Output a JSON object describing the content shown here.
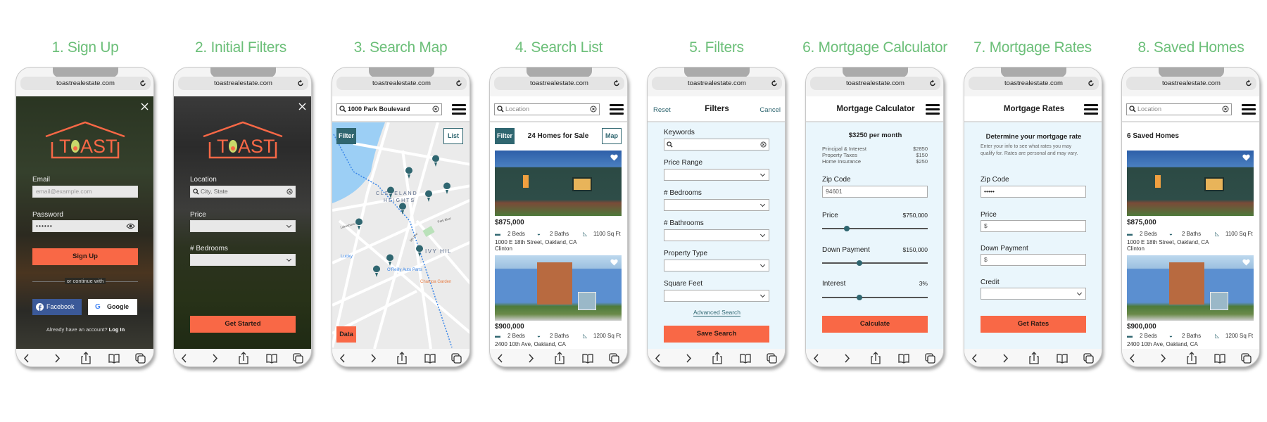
{
  "colors": {
    "accent": "#f96846",
    "teal": "#2f6670",
    "title_green": "#6cbf79",
    "filter_bg": "#eaf6fc",
    "facebook": "#3b5998"
  },
  "browser": {
    "url": "toastrealestate.com",
    "icons": [
      "reload-icon",
      "back-icon",
      "forward-icon",
      "share-icon",
      "bookmarks-icon",
      "tabs-icon"
    ]
  },
  "screens": [
    {
      "title": "1. Sign Up",
      "logo_text": "TOAST",
      "email_label": "Email",
      "email_placeholder": "email@example.com",
      "password_label": "Password",
      "password_value": "••••••",
      "signup_button": "Sign Up",
      "divider_text": "or continue with",
      "facebook_button": "Facebook",
      "google_button": "Google",
      "login_prompt": "Already have an account?",
      "login_link": "Log In"
    },
    {
      "title": "2. Initial Filters",
      "logo_text": "TOAST",
      "location_label": "Location",
      "location_placeholder": "City, State",
      "price_label": "Price",
      "bedrooms_label": "# Bedrooms",
      "get_started_button": "Get Started"
    },
    {
      "title": "3. Search Map",
      "search_value": "1000 Park Boulevard",
      "filter_button": "Filter",
      "list_button": "List",
      "data_button": "Data",
      "map_labels": [
        "CLEVELAND",
        "HEIGHTS",
        "IVY HIL",
        "Lucky",
        "O'Reilly Auto Parts",
        "Champa Garden",
        "Lakeshore Ave",
        "Park Blvd",
        "5th Ave"
      ]
    },
    {
      "title": "4. Search List",
      "search_placeholder": "Location",
      "filter_button": "Filter",
      "heading": "24 Homes for Sale",
      "map_button": "Map"
    },
    {
      "title": "5. Filters",
      "reset": "Reset",
      "heading": "Filters",
      "cancel": "Cancel",
      "fields": [
        "Keywords",
        "Price Range",
        "# Bedrooms",
        "# Bathrooms",
        "Property Type",
        "Square Feet"
      ],
      "advanced_link": "Advanced Search",
      "save_button": "Save Search"
    },
    {
      "title": "6. Mortgage Calculator",
      "heading": "Mortgage Calculator",
      "monthly": "$3250 per month",
      "breakdown": [
        {
          "label": "Principal & Interest",
          "value": "$2850"
        },
        {
          "label": "Property Taxes",
          "value": "$150"
        },
        {
          "label": "Home Insurance",
          "value": "$250"
        }
      ],
      "zip_label": "Zip Code",
      "zip_value": "94601",
      "price_label": "Price",
      "price_value": "$750,000",
      "price_slider": 0.23,
      "down_label": "Down Payment",
      "down_value": "$150,000",
      "down_slider": 0.35,
      "interest_label": "Interest",
      "interest_value": "3%",
      "interest_slider": 0.35,
      "calculate_button": "Calculate"
    },
    {
      "title": "7. Mortgage Rates",
      "heading": "Mortgage Rates",
      "subheading": "Determine your mortgage rate",
      "description": "Enter your info to see what rates you may qualify for. Rates are personal and may vary.",
      "zip_label": "Zip Code",
      "zip_value": "•••••",
      "price_label": "Price",
      "price_placeholder": "$",
      "down_label": "Down Payment",
      "down_placeholder": "$",
      "credit_label": "Credit",
      "rates_button": "Get Rates"
    },
    {
      "title": "8. Saved Homes",
      "search_placeholder": "Location",
      "heading": "6 Saved Homes"
    }
  ],
  "listings": [
    {
      "price": "$875,000",
      "beds": "2 Beds",
      "baths": "2 Baths",
      "sqft": "1100 Sq Ft",
      "address": "1000 E 18th Street, Oakland, CA",
      "neighborhood": "Clinton"
    },
    {
      "price": "$900,000",
      "beds": "2 Beds",
      "baths": "2 Baths",
      "sqft": "1200 Sq Ft",
      "address": "2400 10th Ave, Oakland, CA"
    }
  ]
}
